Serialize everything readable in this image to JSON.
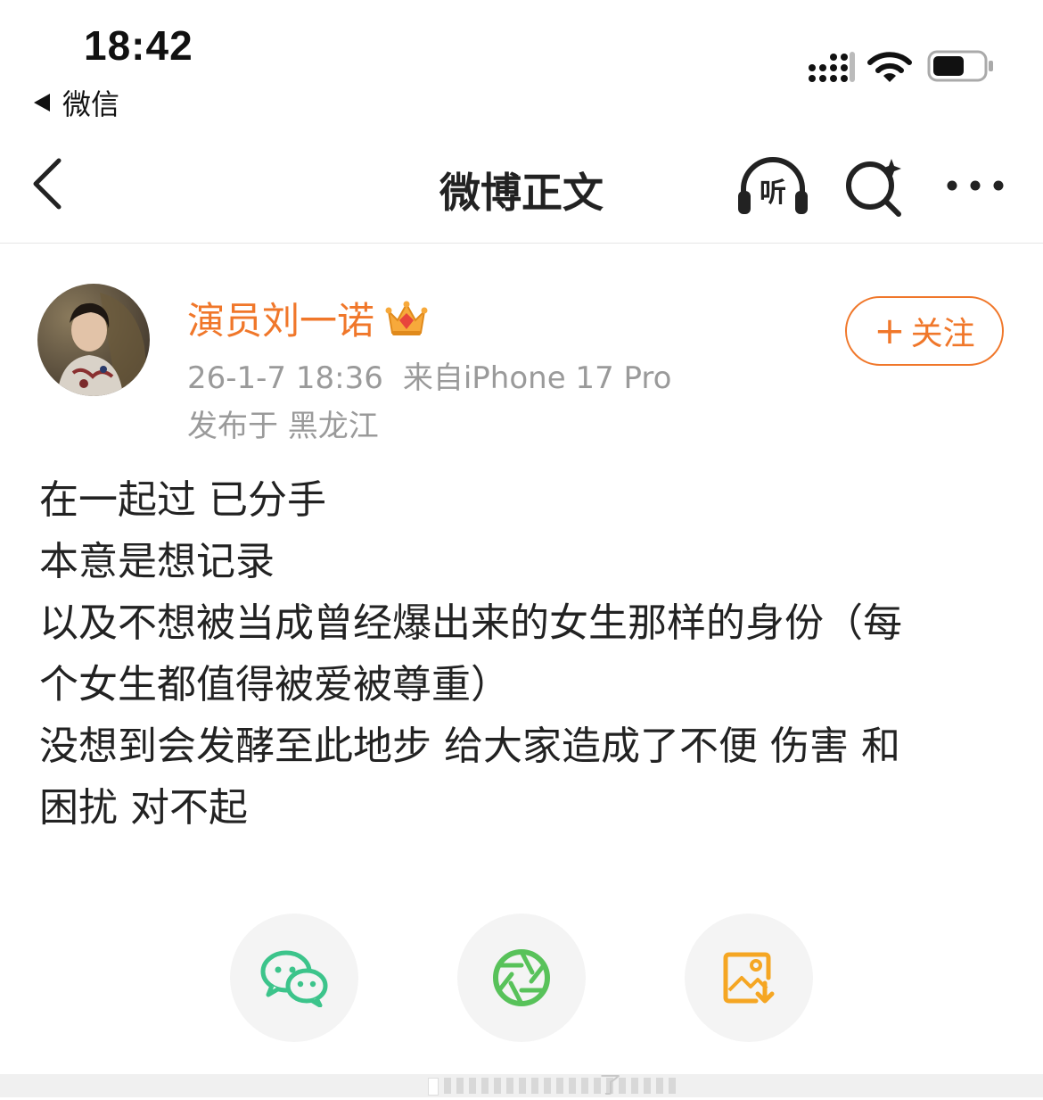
{
  "status_bar": {
    "time": "18:42",
    "back_app": "微信"
  },
  "nav": {
    "title": "微博正文",
    "listen_label": "听"
  },
  "post": {
    "author": "演员刘一诺",
    "follow_label": "关注",
    "meta_time": "26-1-7 18:36",
    "meta_source": "来自iPhone 17 Pro",
    "location": "发布于 黑龙江",
    "lines": [
      "在一起过 已分手",
      "本意是想记录",
      "以及不想被当成曾经爆出来的女生那样的身份（每",
      "个女生都值得被爱被尊重）",
      "没想到会发酵至此地步 给大家造成了不便 伤害 和",
      "困扰 对不起"
    ]
  },
  "share": {
    "items": [
      "wechat-icon",
      "moments-icon",
      "save-image-icon"
    ]
  },
  "bottom": {
    "glyph": "了"
  },
  "colors": {
    "accent": "#f0772a",
    "wechat": "#3cc48b",
    "moments": "#58c25a",
    "save": "#f5a623",
    "meta": "#9a9a9a"
  }
}
